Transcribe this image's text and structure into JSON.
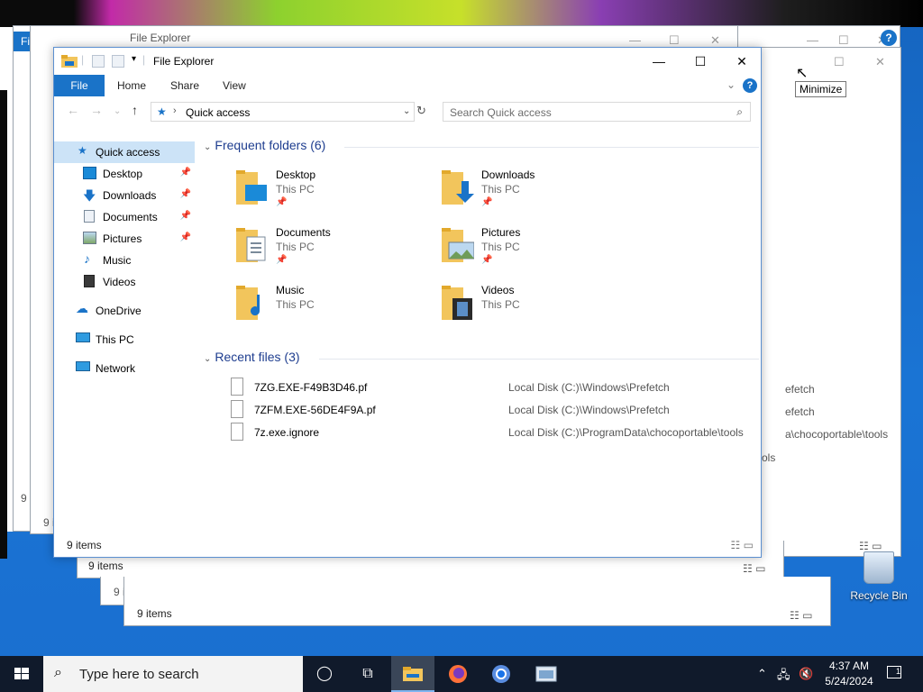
{
  "window": {
    "title": "File Explorer",
    "ribbon_tabs": [
      "File",
      "Home",
      "Share",
      "View"
    ],
    "address_path": "Quick access",
    "search_placeholder": "Search Quick access",
    "status_text": "9 items"
  },
  "sidebar": {
    "items": [
      {
        "label": "Quick access",
        "icon": "star-icon",
        "selected": true
      },
      {
        "label": "Desktop",
        "icon": "desktop-icon",
        "pinned": true
      },
      {
        "label": "Downloads",
        "icon": "download-icon",
        "pinned": true
      },
      {
        "label": "Documents",
        "icon": "document-icon",
        "pinned": true
      },
      {
        "label": "Pictures",
        "icon": "picture-icon",
        "pinned": true
      },
      {
        "label": "Music",
        "icon": "music-icon"
      },
      {
        "label": "Videos",
        "icon": "video-icon"
      },
      {
        "label": "OneDrive",
        "icon": "cloud-icon"
      },
      {
        "label": "This PC",
        "icon": "computer-icon"
      },
      {
        "label": "Network",
        "icon": "network-icon"
      }
    ]
  },
  "frequent": {
    "header": "Frequent folders (6)",
    "folders": [
      {
        "name": "Desktop",
        "location": "This PC",
        "pinned": true
      },
      {
        "name": "Downloads",
        "location": "This PC",
        "pinned": true
      },
      {
        "name": "Documents",
        "location": "This PC",
        "pinned": true
      },
      {
        "name": "Pictures",
        "location": "This PC",
        "pinned": true
      },
      {
        "name": "Music",
        "location": "This PC"
      },
      {
        "name": "Videos",
        "location": "This PC"
      }
    ]
  },
  "recent": {
    "header": "Recent files (3)",
    "files": [
      {
        "name": "7ZG.EXE-F49B3D46.pf",
        "path": "Local Disk (C:)\\Windows\\Prefetch"
      },
      {
        "name": "7ZFM.EXE-56DE4F9A.pf",
        "path": "Local Disk (C:)\\Windows\\Prefetch"
      },
      {
        "name": "7z.exe.ignore",
        "path": "Local Disk (C:)\\ProgramData\\chocoportable\\tools"
      }
    ]
  },
  "ghost": {
    "title": "File Explorer",
    "status_text": "9 items",
    "ghost_file_text": "Fi",
    "path_fragments": [
      "efetch",
      "efetch",
      "a\\chocoportable\\tools",
      "ols"
    ],
    "stray_texts": [
      "9 i",
      "9 i",
      "9 i"
    ]
  },
  "tooltip": "Minimize",
  "desktop": {
    "recycle_bin_label": "Recycle Bin"
  },
  "taskbar": {
    "search_placeholder": "Type here to search",
    "time": "4:37 AM",
    "date": "5/24/2024",
    "notification_count": "1"
  },
  "colors": {
    "accent": "#1a73c8",
    "taskbar": "#101a2b",
    "selected": "#cce3f7"
  }
}
